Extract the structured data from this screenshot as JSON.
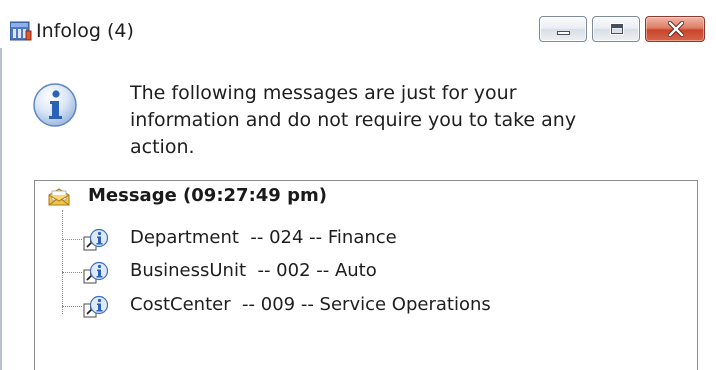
{
  "window": {
    "title": "Infolog (4)",
    "icon": "infolog-app-icon",
    "controls": {
      "minimize": "minimize-icon",
      "maximize": "maximize-icon",
      "close": "close-icon"
    }
  },
  "info": {
    "icon": "information-icon",
    "lines": [
      "The following messages are just for your",
      "information and do not require you to take any",
      "action."
    ]
  },
  "tree": {
    "root": {
      "icon": "envelope-icon",
      "label": "Message (09:27:49 pm)"
    },
    "items": [
      {
        "label": "Department  -- 024 -- Finance",
        "icon": "info-message-icon"
      },
      {
        "label": "BusinessUnit  -- 002 -- Auto",
        "icon": "info-message-icon"
      },
      {
        "label": "CostCenter  -- 009 -- Service Operations",
        "icon": "info-message-icon"
      }
    ]
  },
  "colors": {
    "close_button": "#c8452b",
    "info_icon_blue": "#2a62b8",
    "panel_border": "#8c8c8c"
  }
}
